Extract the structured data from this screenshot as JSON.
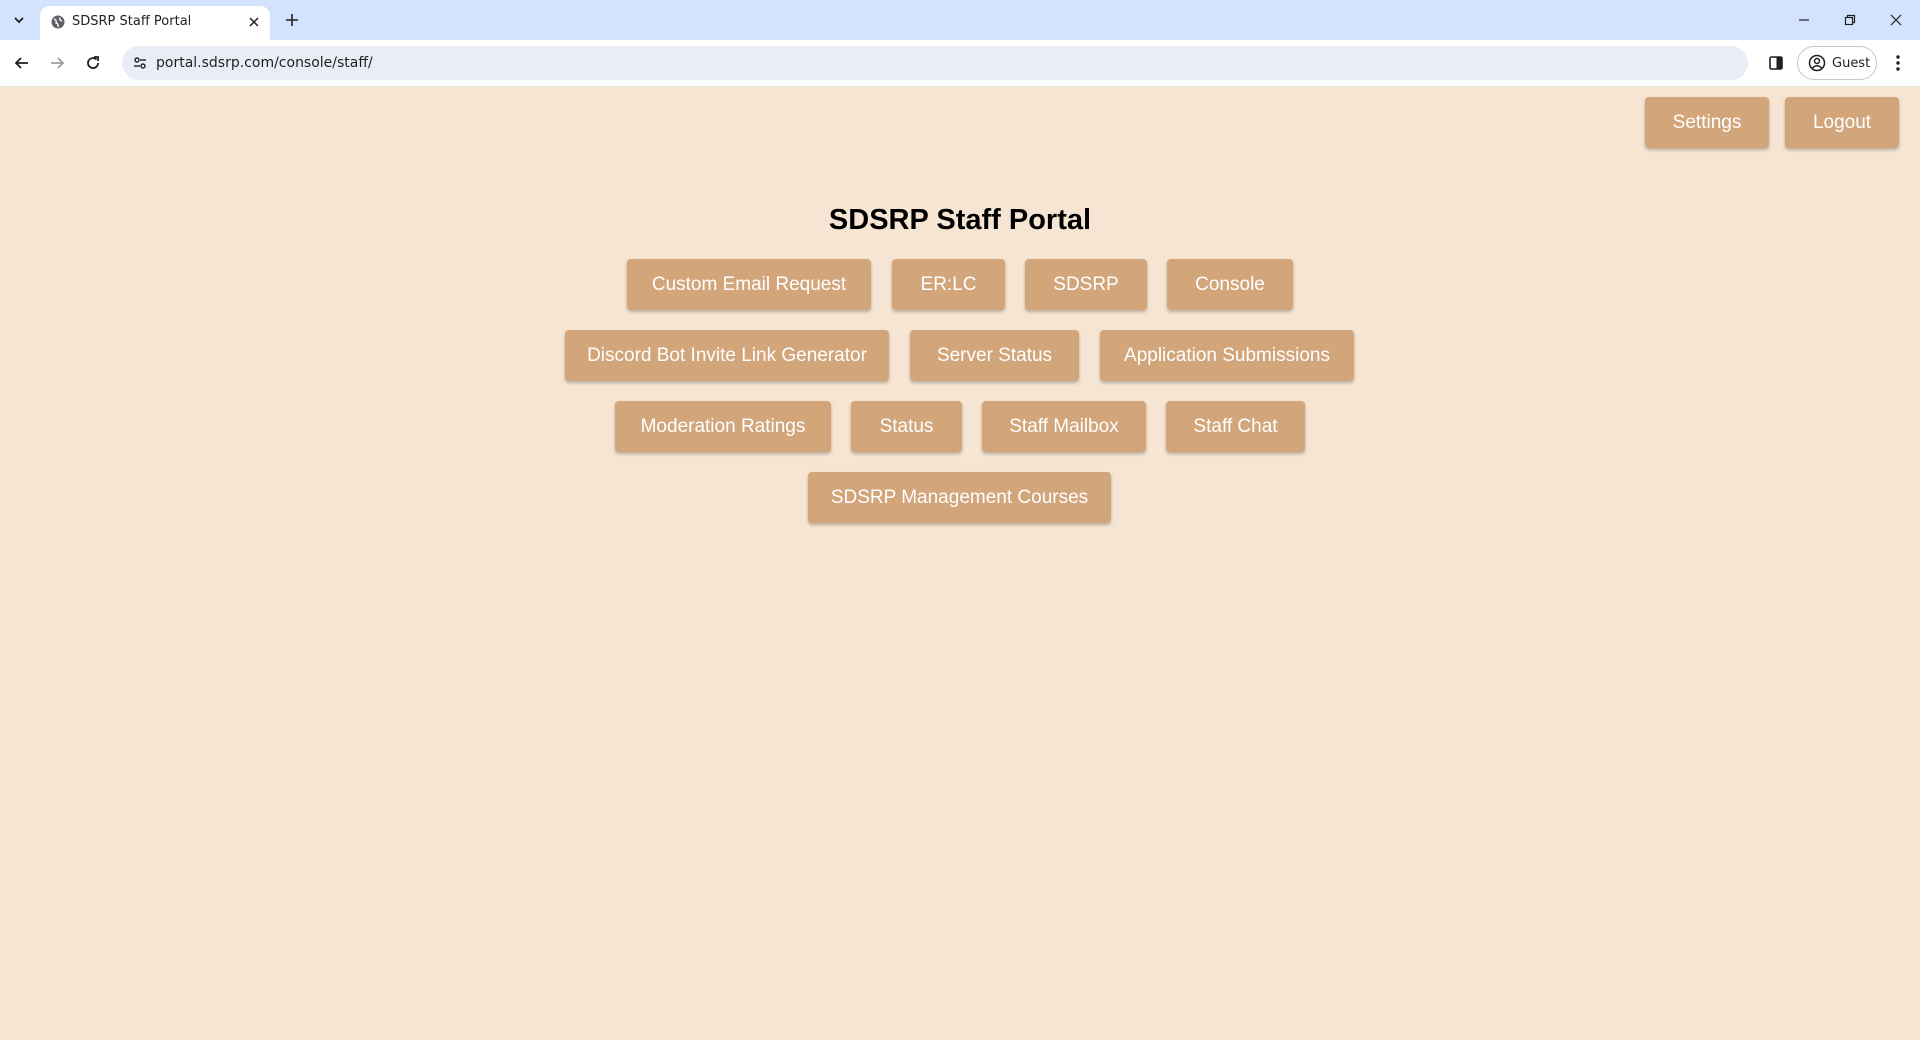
{
  "browser": {
    "tab_title": "SDSRP Staff Portal",
    "url": "portal.sdsrp.com/console/staff/",
    "profile_label": "Guest"
  },
  "header": {
    "settings_label": "Settings",
    "logout_label": "Logout"
  },
  "main": {
    "title": "SDSRP Staff Portal",
    "rows": [
      [
        "Custom Email Request",
        "ER:LC",
        "SDSRP",
        "Console"
      ],
      [
        "Discord Bot Invite Link Generator",
        "Server Status",
        "Application Submissions"
      ],
      [
        "Moderation Ratings",
        "Status",
        "Staff Mailbox",
        "Staff Chat"
      ],
      [
        "SDSRP Management Courses"
      ]
    ]
  },
  "colors": {
    "page_background": "#f5e5d2",
    "button_background": "#d2a57a",
    "button_text": "#ffffff"
  }
}
